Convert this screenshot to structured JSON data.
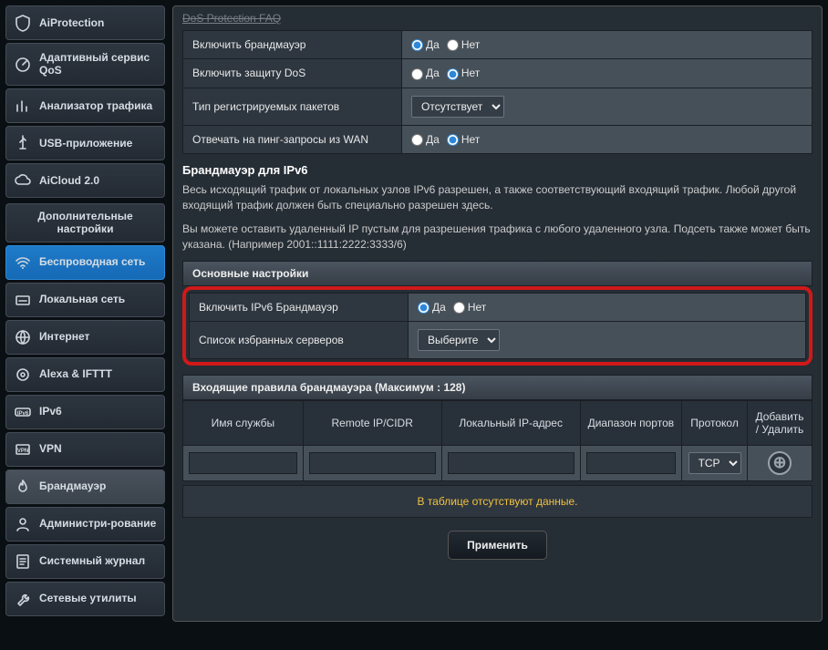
{
  "sidebar": {
    "top": [
      {
        "icon": "shield",
        "label": "AiProtection"
      },
      {
        "icon": "gauge",
        "label": "Адаптивный сервис QoS"
      },
      {
        "icon": "bars",
        "label": "Анализатор трафика"
      },
      {
        "icon": "usb",
        "label": "USB-приложение"
      },
      {
        "icon": "cloud",
        "label": "AiCloud 2.0"
      }
    ],
    "section_title": "Дополнительные настройки",
    "bottom": [
      {
        "icon": "wifi",
        "label": "Беспроводная сеть",
        "active": "blue"
      },
      {
        "icon": "lan",
        "label": "Локальная сеть"
      },
      {
        "icon": "globe",
        "label": "Интернет"
      },
      {
        "icon": "alexa",
        "label": "Alexa & IFTTT"
      },
      {
        "icon": "ipv6",
        "label": "IPv6"
      },
      {
        "icon": "vpn",
        "label": "VPN"
      },
      {
        "icon": "flame",
        "label": "Брандмауэр",
        "active": "grey"
      },
      {
        "icon": "admin",
        "label": "Администри-рование"
      },
      {
        "icon": "log",
        "label": "Системный журнал"
      },
      {
        "icon": "tools",
        "label": "Сетевые утилиты"
      }
    ]
  },
  "main": {
    "top_link": "DoS Protection FAQ",
    "rows": [
      {
        "label": "Включить брандмауэр",
        "type": "radio",
        "yes": "Да",
        "no": "Нет",
        "value": "yes"
      },
      {
        "label": "Включить защиту DoS",
        "type": "radio",
        "yes": "Да",
        "no": "Нет",
        "value": "no"
      },
      {
        "label": "Тип регистрируемых пакетов",
        "type": "select",
        "option": "Отсутствует"
      },
      {
        "label": "Отвечать на пинг-запросы из WAN",
        "type": "radio",
        "yes": "Да",
        "no": "Нет",
        "value": "no"
      }
    ],
    "ipv6_title": "Брандмауэр для IPv6",
    "ipv6_text1": "Весь исходящий трафик от локальных узлов IPv6 разрешен, а также соответствующий входящий трафик. Любой другой входящий трафик должен быть специально разрешен здесь.",
    "ipv6_text2": "Вы можете оставить удаленный IP пустым для разрешения трафика с любого удаленного узла. Подсеть также может быть указана. (Например 2001::1111:2222:3333/6)",
    "basic_settings_title": "Основные настройки",
    "basic_rows": [
      {
        "label": "Включить IPv6 Брандмауэр",
        "type": "radio",
        "yes": "Да",
        "no": "Нет",
        "value": "yes"
      },
      {
        "label": "Список избранных серверов",
        "type": "select",
        "option": "Выберите"
      }
    ],
    "rules_title": "Входящие правила брандмауэра (Максимум : 128)",
    "cols": {
      "service": "Имя службы",
      "remote": "Remote IP/CIDR",
      "local": "Локальный IP-адрес",
      "ports": "Диапазон портов",
      "proto": "Протокол",
      "action": "Добавить / Удалить"
    },
    "proto_option": "TCP",
    "no_data": "В таблице отсутствуют данные.",
    "apply": "Применить"
  }
}
